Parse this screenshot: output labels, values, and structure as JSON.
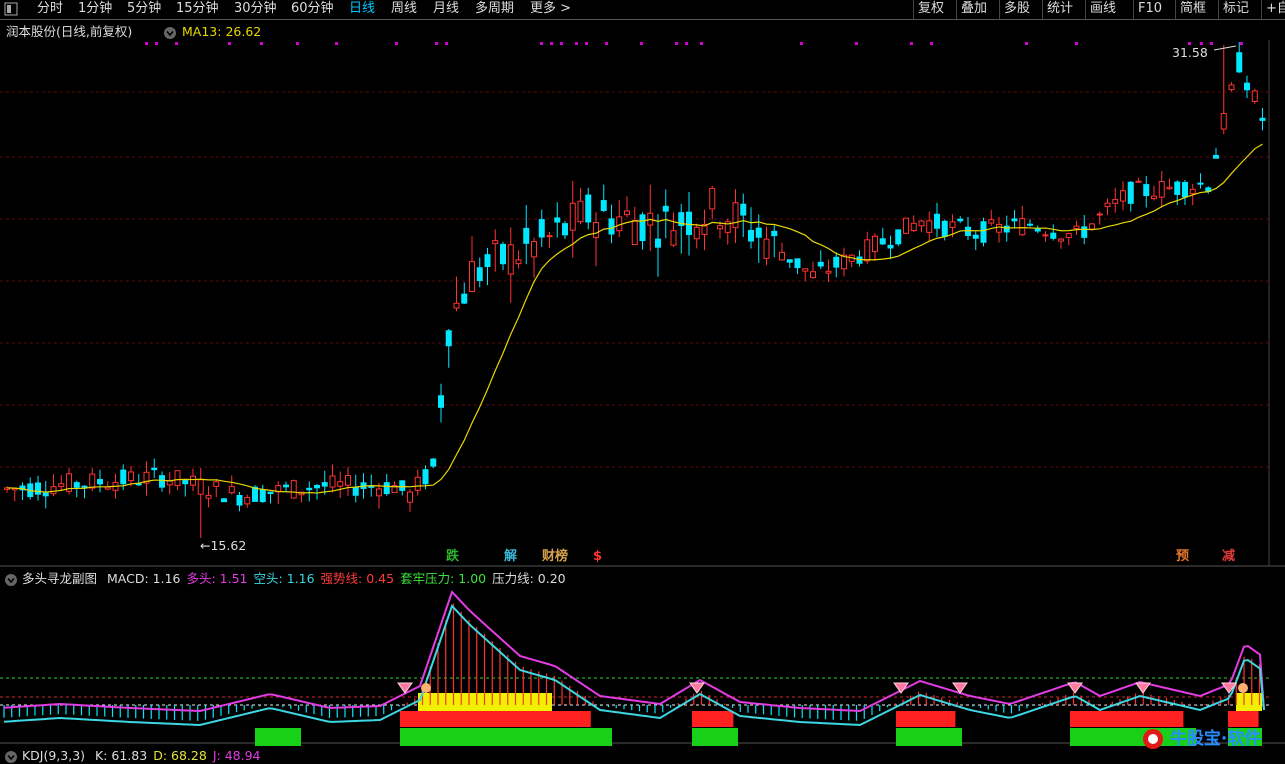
{
  "toolbar": {
    "periods": [
      "分时",
      "1分钟",
      "5分钟",
      "15分钟",
      "30分钟",
      "60分钟",
      "日线",
      "周线",
      "月线",
      "多周期",
      "更多 >"
    ],
    "active_period": "日线",
    "actions": [
      "复权",
      "叠加",
      "多股",
      "统计",
      "画线",
      "F10",
      "简框",
      "标记",
      "+自"
    ]
  },
  "main_chart": {
    "title": "润本股份(日线,前复权)",
    "ma_label": "MA13:",
    "ma_value": "26.62",
    "high_label": "31.58",
    "low_label": "15.62",
    "event_markers": [
      {
        "text": "跌",
        "color": "#2db52d"
      },
      {
        "text": "解",
        "color": "#3bb8d8"
      },
      {
        "text": "财榜",
        "color": "#d6a14d"
      },
      {
        "text": "$",
        "color": "#ff3232"
      },
      {
        "text": "预",
        "color": "#e7782d"
      },
      {
        "text": "减",
        "color": "#e43a3a"
      }
    ]
  },
  "indicator": {
    "name": "多头寻龙副图",
    "items": [
      {
        "label": "MACD:",
        "value": "1.16",
        "color": "#dddddd"
      },
      {
        "label": "多头:",
        "value": "1.51",
        "color": "#e23ce2"
      },
      {
        "label": "空头:",
        "value": "1.16",
        "color": "#3cd7e2"
      },
      {
        "label": "强势线:",
        "value": "0.45",
        "color": "#ff3c3c"
      },
      {
        "label": "套牢压力:",
        "value": "1.00",
        "color": "#3ce23c"
      },
      {
        "label": "压力线:",
        "value": "0.20",
        "color": "#dddddd"
      }
    ]
  },
  "kdj": {
    "name": "KDJ(9,3,3)",
    "items": [
      {
        "label": "K:",
        "value": "61.83",
        "color": "#dddddd"
      },
      {
        "label": "D:",
        "value": "68.28",
        "color": "#e2e23c"
      },
      {
        "label": "J:",
        "value": "48.94",
        "color": "#e23ce2"
      }
    ]
  },
  "watermark": "牛股宝·软件",
  "colors": {
    "up": "#ff3232",
    "down": "#00e8ff",
    "ma": "#e8d800",
    "active": "#00c8ff"
  }
}
